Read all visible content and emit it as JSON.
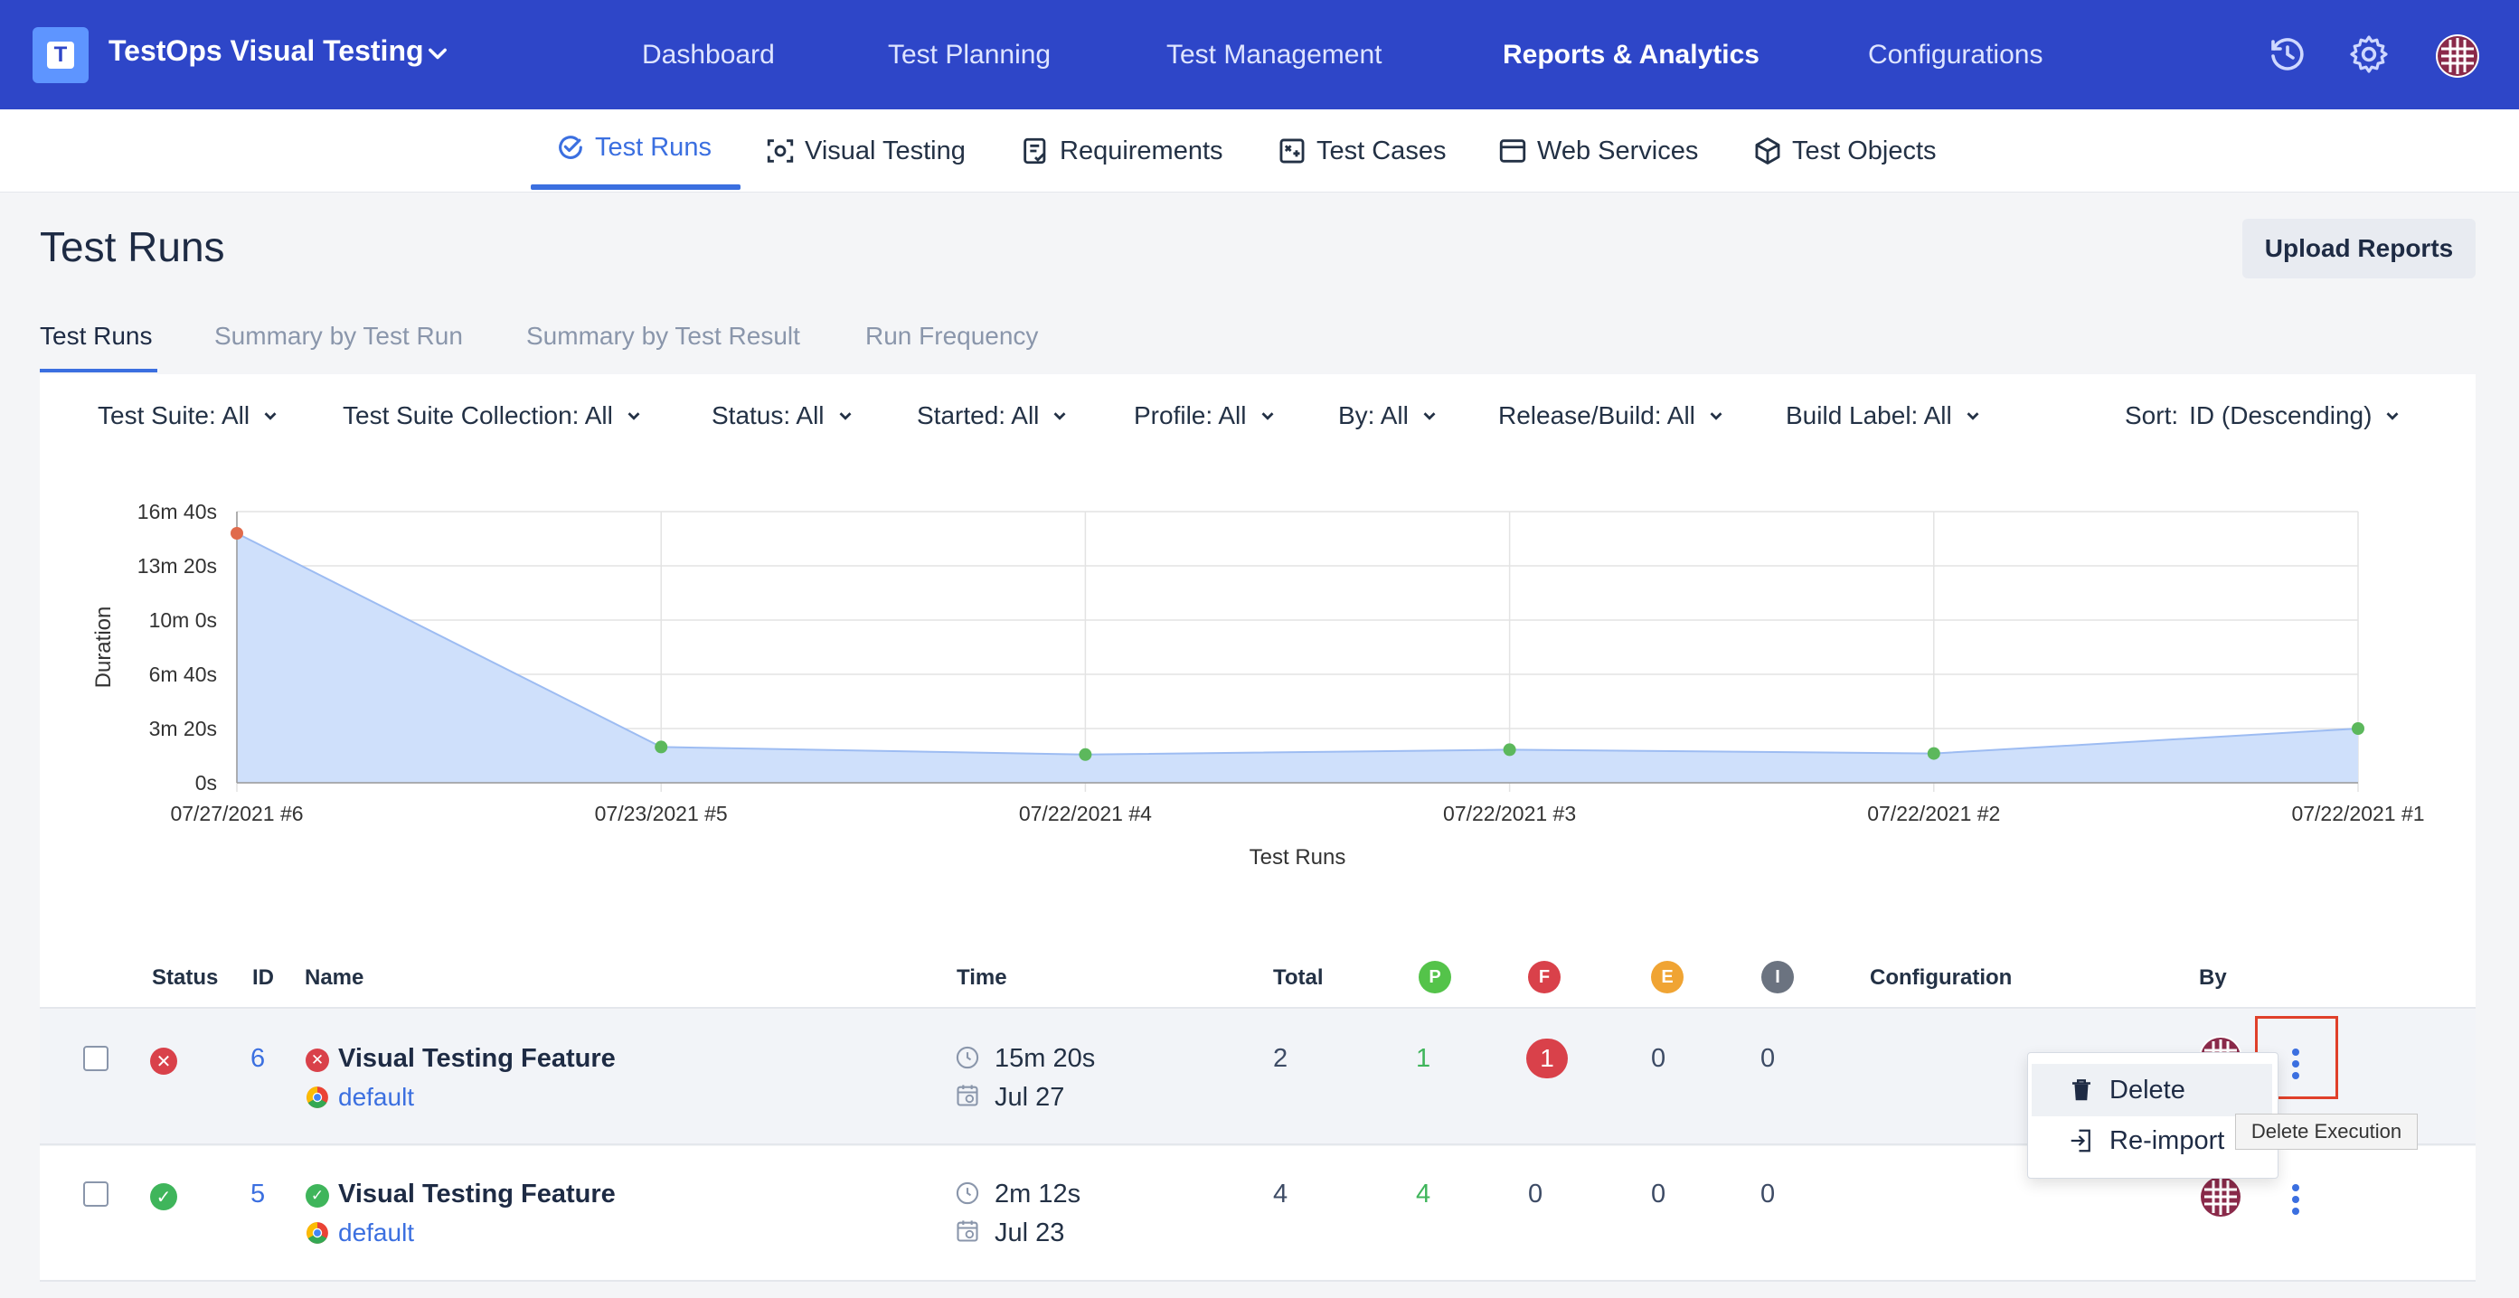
{
  "app": {
    "title": "TestOps Visual Testing",
    "logo_letter": "T"
  },
  "topnav": {
    "items": [
      "Dashboard",
      "Test Planning",
      "Test Management",
      "Reports & Analytics",
      "Configurations"
    ],
    "active": "Reports & Analytics",
    "icons": [
      "history-icon",
      "gear-icon",
      "user-avatar"
    ]
  },
  "subnav": {
    "items": [
      {
        "label": "Test Runs",
        "icon": "check-circle-icon",
        "active": true
      },
      {
        "label": "Visual Testing",
        "icon": "camera-focus-icon"
      },
      {
        "label": "Requirements",
        "icon": "requirements-icon"
      },
      {
        "label": "Test Cases",
        "icon": "test-case-icon"
      },
      {
        "label": "Web Services",
        "icon": "window-icon"
      },
      {
        "label": "Test Objects",
        "icon": "cube-icon"
      }
    ]
  },
  "page": {
    "title": "Test Runs",
    "upload_label": "Upload Reports"
  },
  "tabs": [
    "Test Runs",
    "Summary by Test Run",
    "Summary by Test Result",
    "Run Frequency"
  ],
  "filters": [
    "Test Suite: All",
    "Test Suite Collection: All",
    "Status: All",
    "Started: All",
    "Profile: All",
    "By: All",
    "Release/Build: All",
    "Build Label: All"
  ],
  "sort": {
    "label": "Sort:",
    "value": "ID (Descending)"
  },
  "chart_data": {
    "type": "area",
    "xlabel": "Test Runs",
    "ylabel": "Duration",
    "categories": [
      "07/27/2021 #6",
      "07/23/2021 #5",
      "07/22/2021 #4",
      "07/22/2021 #3",
      "07/22/2021 #2",
      "07/22/2021 #1"
    ],
    "y_ticks": [
      "0s",
      "3m 20s",
      "6m 40s",
      "10m 0s",
      "13m 20s",
      "16m 40s"
    ],
    "ylim_seconds": [
      0,
      1000
    ],
    "values_seconds": [
      920,
      132,
      104,
      122,
      108,
      200
    ],
    "point_status": [
      "failed",
      "passed",
      "passed",
      "passed",
      "passed",
      "passed"
    ],
    "colors": {
      "fill": "#cfe0fb",
      "line": "#9dbcf2",
      "passed": "#5cb85c",
      "failed": "#e06b4c",
      "grid": "#e3e3e3"
    },
    "grid": true
  },
  "table": {
    "headers": {
      "status": "Status",
      "id": "ID",
      "name": "Name",
      "time": "Time",
      "total": "Total",
      "passed": "P",
      "failed": "F",
      "error": "E",
      "incomplete": "I",
      "configuration": "Configuration",
      "by": "By"
    },
    "rows": [
      {
        "status": "failed",
        "id": "6",
        "name": "Visual Testing Feature",
        "profile": "default",
        "duration": "15m 20s",
        "date": "Jul 27",
        "total": "2",
        "passed": "1",
        "failed": "1",
        "error": "0",
        "incomplete": "0"
      },
      {
        "status": "passed",
        "id": "5",
        "name": "Visual Testing Feature",
        "profile": "default",
        "duration": "2m 12s",
        "date": "Jul 23",
        "total": "4",
        "passed": "4",
        "failed": "0",
        "error": "0",
        "incomplete": "0"
      }
    ]
  },
  "context_menu": {
    "items": [
      "Delete",
      "Re-import"
    ],
    "tooltip": "Delete Execution"
  }
}
